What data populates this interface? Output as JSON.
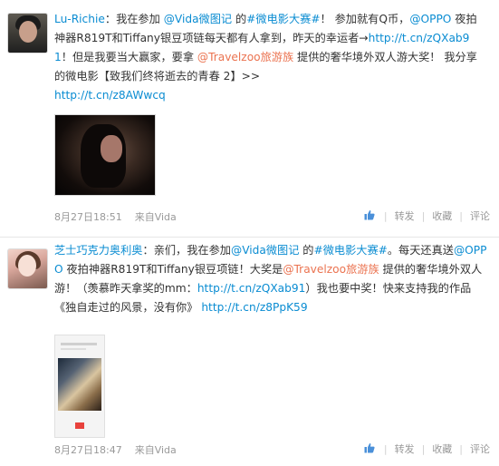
{
  "posts": [
    {
      "user": "Lu-Richie",
      "colon": "：",
      "segments": {
        "a": "我在参加 ",
        "mention_vida": "@Vida微图记",
        "b": " 的",
        "topic": "#微电影大赛#",
        "c": "！ 参加就有Q币，",
        "mention_oppo": "@OPPO",
        "d": " 夜拍神器R819T和Tiffany银豆项链每天都有人拿到，昨天的幸运者→",
        "link1": "http://t.cn/zQXab91",
        "e": "！但是我要当大赢家，要拿 ",
        "mention_travelzoo": "@Travelzoo旅游族",
        "f": " 提供的奢华境外双人游大奖！ 我分享的微电影【致我们终将逝去的青春 2】>>",
        "link2": "http://t.cn/z8AWwcq"
      },
      "time": "8月27日18:51",
      "source": "来自Vida",
      "actions": {
        "forward": "转发",
        "favorite": "收藏",
        "comment": "评论",
        "separator": "|"
      }
    },
    {
      "user": "芝士巧克力奥利奥",
      "colon": "：",
      "segments": {
        "a": "亲们，我在参加",
        "mention_vida": "@Vida微图记",
        "b": " 的",
        "topic": "#微电影大赛#",
        "c": "。每天还真送",
        "mention_oppo": "@OPPO",
        "d": " 夜拍神器R819T和Tiffany银豆项链！大奖是",
        "mention_travelzoo": "@Travelzoo旅游族",
        "e": " 提供的奢华境外双人游！（羡慕昨天拿奖的mm：",
        "link1": "http://t.cn/zQXab91",
        "f": "）我也要中奖！快来支持我的作品《独自走过的风景，没有你》 ",
        "link2": "http://t.cn/z8PpK59"
      },
      "time": "8月27日18:47",
      "source": "来自Vida",
      "actions": {
        "forward": "转发",
        "favorite": "收藏",
        "comment": "评论",
        "separator": "|"
      }
    }
  ],
  "colors": {
    "link": "#0a8cd2",
    "brand": "#eb7350",
    "meta": "#999999"
  },
  "icons": [
    "thumbs-up-icon"
  ]
}
